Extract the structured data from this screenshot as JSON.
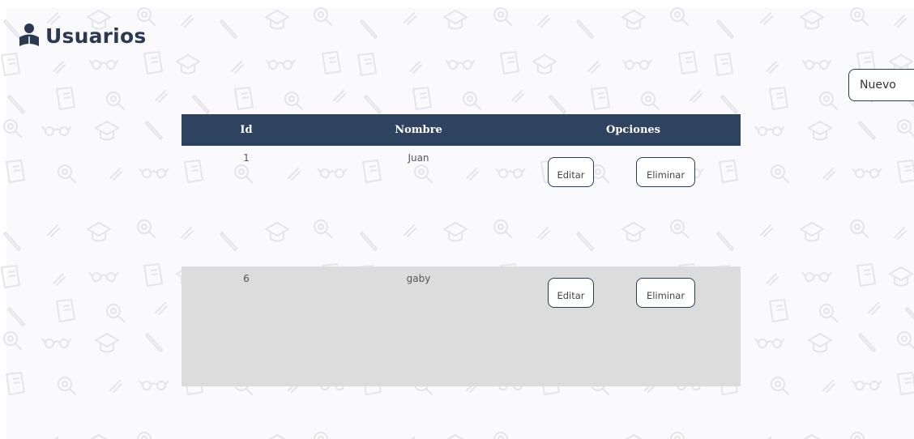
{
  "header": {
    "title": "Usuarios",
    "icon": "user-book-icon"
  },
  "toolbar": {
    "new_label": "Nuevo"
  },
  "table": {
    "columns": [
      "Id",
      "Nombre",
      "Opciones"
    ],
    "rows": [
      {
        "id": "1",
        "nombre": "Juan",
        "edit_label": "Editar",
        "delete_label": "Eliminar"
      },
      {
        "id": "6",
        "nombre": "gaby",
        "edit_label": "Editar",
        "delete_label": "Eliminar"
      }
    ]
  },
  "colors": {
    "header_bg": "#2e4360",
    "accent": "#2b3a52",
    "row_alt_bg": "#dcdcdc",
    "page_bg": "#fafafc"
  },
  "background_icons": [
    "pencil-icon",
    "graduation-cap-icon",
    "magnifier-icon",
    "glasses-icon",
    "book-icon",
    "ruler-icon"
  ]
}
